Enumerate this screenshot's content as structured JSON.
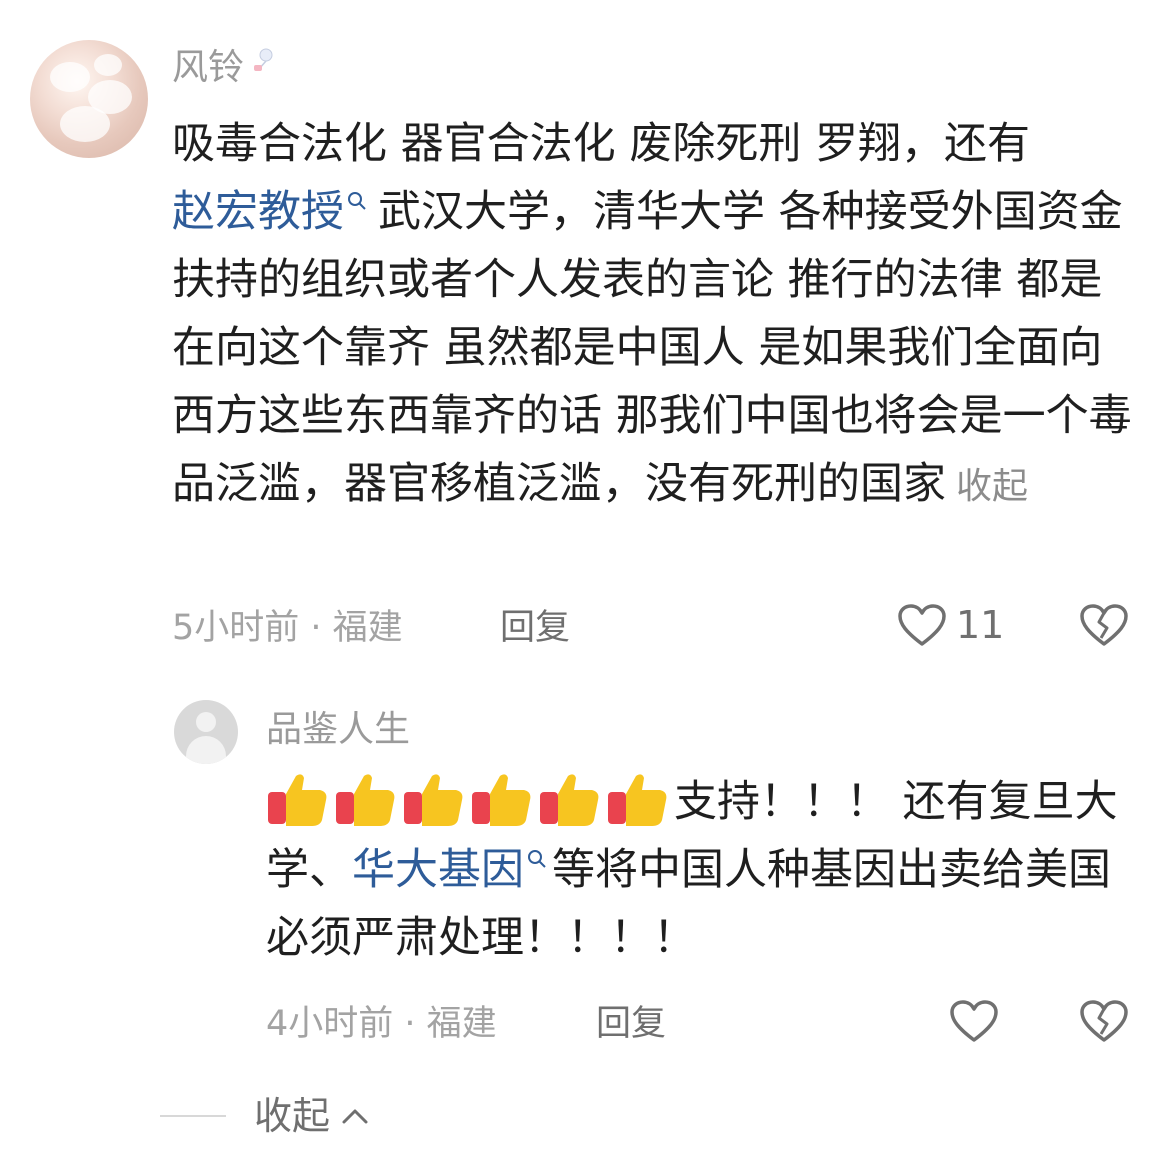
{
  "comments": [
    {
      "username": "风铃",
      "badge_icon": "wind-chime-icon",
      "content": {
        "part1": "吸毒合法化 器官合法化 废除死刑  罗翔，还有",
        "link1": "赵宏教授",
        "part2": "武汉大学，清华大学 各种接受外国资金扶持的组织或者个人发表的言论 推行的法律 都是在向这个靠齐 虽然都是中国人 是如果我们全面向西方这些东西靠齐的话 那我们中国也将会是一个毒品泛滥，器官移植泛滥，没有死刑的国家",
        "collapse": "收起"
      },
      "time": "5小时前",
      "location": "福建",
      "reply_label": "回复",
      "like_count": "11"
    },
    {
      "username": "品鉴人生",
      "content": {
        "part1": "支持！！！ 还有复旦大学、",
        "link1": "华大基因",
        "part2": "等将中国人种基因出卖给美国必须严肃处理！！！！",
        "emoji": "thumbs-up-icon"
      },
      "time": "4小时前",
      "location": "福建",
      "reply_label": "回复",
      "like_count": ""
    }
  ],
  "footer": {
    "collapse_label": "收起"
  },
  "separator": " · "
}
